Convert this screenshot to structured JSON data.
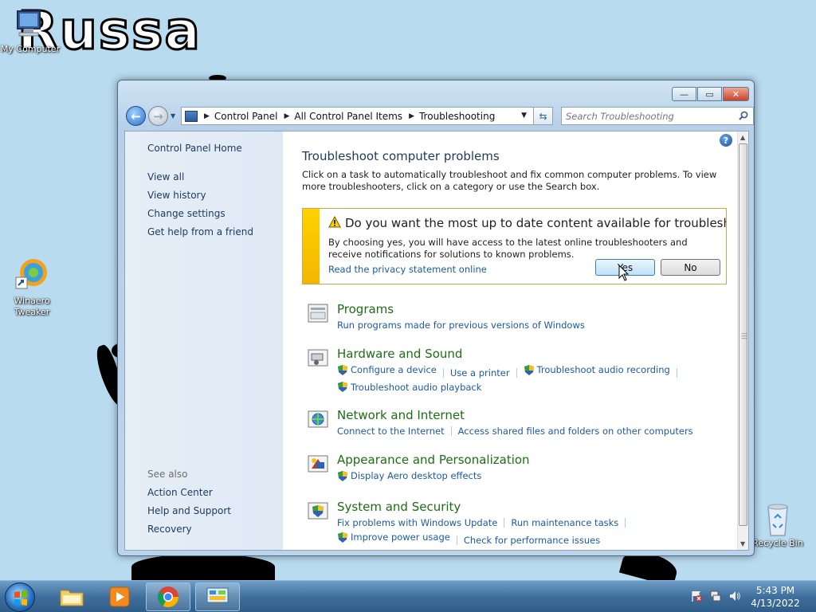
{
  "desktop": {
    "wallpaper_text": "Russa",
    "icons": [
      {
        "label": "My Computer"
      },
      {
        "label": "Winaero Tweaker"
      },
      {
        "label": "Recycle Bin"
      }
    ]
  },
  "window": {
    "controls": {
      "minimize": "—",
      "maximize": "▭",
      "close": "✕"
    },
    "address": {
      "crumbs": [
        "Control Panel",
        "All Control Panel Items",
        "Troubleshooting"
      ]
    },
    "search": {
      "placeholder": "Search Troubleshooting"
    },
    "sidebar": {
      "home": "Control Panel Home",
      "links": [
        "View all",
        "View history",
        "Change settings",
        "Get help from a friend"
      ],
      "see_also_heading": "See also",
      "see_also": [
        "Action Center",
        "Help and Support",
        "Recovery"
      ]
    },
    "content": {
      "title": "Troubleshoot computer problems",
      "intro": "Click on a task to automatically troubleshoot and fix common computer problems. To view more troubleshooters, click on a category or use the Search box.",
      "infobar": {
        "title": "Do you want the most up to date content available for troubleshoot...",
        "text": "By choosing yes, you will have access to the latest online troubleshooters and receive notifications for solutions to known problems.",
        "link": "Read the privacy statement online",
        "yes": "Yes",
        "no": "No"
      },
      "categories": [
        {
          "title": "Programs",
          "links": [
            {
              "text": "Run programs made for previous versions of Windows",
              "shield": false
            }
          ]
        },
        {
          "title": "Hardware and Sound",
          "links": [
            {
              "text": "Configure a device",
              "shield": true
            },
            {
              "text": "Use a printer",
              "shield": false
            },
            {
              "text": "Troubleshoot audio recording",
              "shield": true
            },
            {
              "text": "Troubleshoot audio playback",
              "shield": true
            }
          ]
        },
        {
          "title": "Network and Internet",
          "links": [
            {
              "text": "Connect to the Internet",
              "shield": false
            },
            {
              "text": "Access shared files and folders on other computers",
              "shield": false
            }
          ]
        },
        {
          "title": "Appearance and Personalization",
          "links": [
            {
              "text": "Display Aero desktop effects",
              "shield": true
            }
          ]
        },
        {
          "title": "System and Security",
          "links": [
            {
              "text": "Fix problems with Windows Update",
              "shield": false
            },
            {
              "text": "Run maintenance tasks",
              "shield": false
            },
            {
              "text": "Improve power usage",
              "shield": true
            },
            {
              "text": "Check for performance issues",
              "shield": false
            }
          ]
        }
      ]
    }
  },
  "taskbar": {
    "items": [
      "start-orb",
      "file-explorer",
      "media-player",
      "chrome",
      "control-panel"
    ],
    "clock": {
      "time": "5:43 PM",
      "date": "4/13/2022"
    }
  },
  "colors": {
    "accent": "#1e5aa6",
    "category_title": "#1c6e14",
    "infobar": "#ffd200",
    "desktop_bg": "#b9dbef"
  }
}
